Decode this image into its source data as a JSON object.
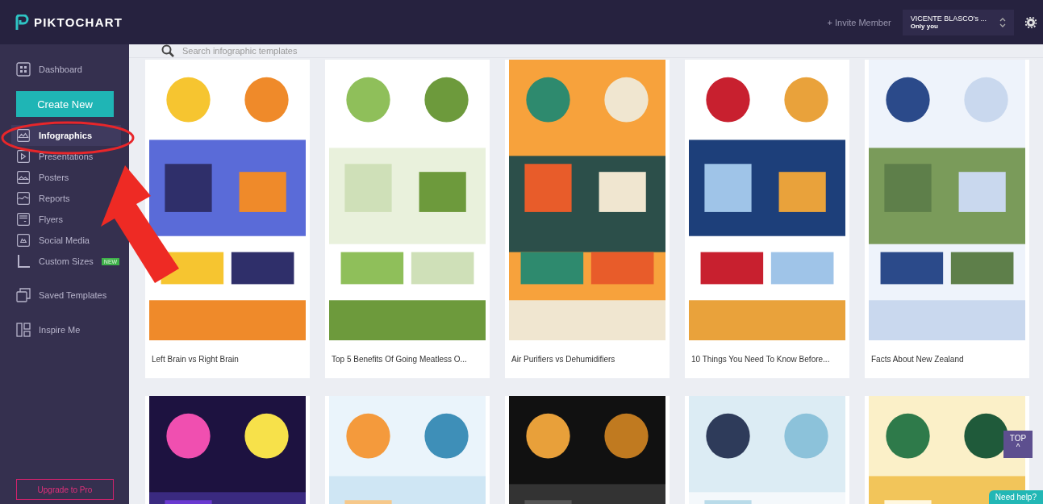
{
  "header": {
    "logo": "PIKTOCHART",
    "invite": "+ Invite Member",
    "account": {
      "name": "VICENTE BLASCO's ...",
      "plan": "Only you"
    }
  },
  "sidebar": {
    "dashboard": "Dashboard",
    "create_button": "Create New",
    "items": [
      {
        "label": "Infographics",
        "selected": true
      },
      {
        "label": "Presentations",
        "selected": false
      },
      {
        "label": "Posters",
        "selected": false
      },
      {
        "label": "Reports",
        "selected": false
      },
      {
        "label": "Flyers",
        "selected": false
      },
      {
        "label": "Social Media",
        "selected": false
      },
      {
        "label": "Custom Sizes",
        "selected": false,
        "badge": "NEW"
      }
    ],
    "extra": [
      "Saved Templates",
      "Inspire Me"
    ],
    "upgrade_button": "Upgrade to Pro"
  },
  "search": {
    "placeholder": "Search infographic templates"
  },
  "templates": [
    {
      "kind": "template",
      "caption": "Left Brain vs Right Brain"
    },
    {
      "kind": "template",
      "caption": "Top 5 Benefits Of Going Meatless O..."
    },
    {
      "kind": "template",
      "caption": "Air Purifiers vs Dehumidifiers"
    },
    {
      "kind": "template",
      "caption": "10 Things You Need To Know Before..."
    },
    {
      "kind": "template",
      "caption": "Facts About New Zealand"
    },
    {
      "kind": "picture"
    },
    {
      "kind": "picture"
    },
    {
      "kind": "picture"
    },
    {
      "kind": "picture"
    },
    {
      "kind": "picture"
    }
  ],
  "top_button": {
    "label": "TOP",
    "arrow": "^"
  },
  "help_button": "Need help?"
}
